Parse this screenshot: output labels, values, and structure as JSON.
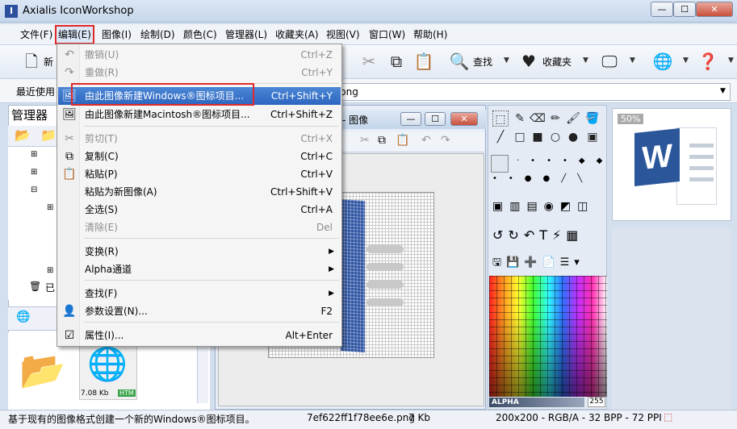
{
  "window": {
    "title": "Axialis IconWorkshop",
    "app_icon": "I",
    "min_label": "—",
    "max_label": "☐",
    "close_label": "✕"
  },
  "menubar": {
    "items": [
      "文件(F)",
      "编辑(E)",
      "图像(I)",
      "绘制(D)",
      "颜色(C)",
      "管理器(L)",
      "收藏夹(A)",
      "视图(V)",
      "窗口(W)",
      "帮助(H)"
    ]
  },
  "toolbar": {
    "new_label": "新",
    "find_label": "查找",
    "favorites_label": "收藏夹"
  },
  "recent": {
    "label": "最近使用",
    "value": "png"
  },
  "left_panel": {
    "title": "管理器",
    "tree_fragment": "已",
    "thumb_size": "7.08 Kb",
    "thumb_badge": "HTM"
  },
  "doc": {
    "title": "- 图像"
  },
  "preview": {
    "zoom": "50%",
    "word_letter": "W"
  },
  "palette": {
    "alpha_label": "ALPHA",
    "alpha_value": "255"
  },
  "status": {
    "message": "基于现有的图像格式创建一个新的Windows®图标项目。",
    "filename": "7ef622ff1f78ee6e.png",
    "filesize": "7 Kb",
    "image_info": "200x200 - RGB/A - 32 BPP - 72 PPI"
  },
  "edit_menu": {
    "undo": {
      "label": "撤销(U)",
      "shortcut": "Ctrl+Z"
    },
    "redo": {
      "label": "重做(R)",
      "shortcut": "Ctrl+Y"
    },
    "new_windows": {
      "label": "由此图像新建Windows®图标项目...",
      "shortcut": "Ctrl+Shift+Y"
    },
    "new_macintosh": {
      "label": "由此图像新建Macintosh®图标项目...",
      "shortcut": "Ctrl+Shift+Z"
    },
    "cut": {
      "label": "剪切(T)",
      "shortcut": "Ctrl+X"
    },
    "copy": {
      "label": "复制(C)",
      "shortcut": "Ctrl+C"
    },
    "paste": {
      "label": "粘贴(P)",
      "shortcut": "Ctrl+V"
    },
    "paste_new": {
      "label": "粘贴为新图像(A)",
      "shortcut": "Ctrl+Shift+V"
    },
    "select_all": {
      "label": "全选(S)",
      "shortcut": "Ctrl+A"
    },
    "clear": {
      "label": "清除(E)",
      "shortcut": "Del"
    },
    "transform": {
      "label": "变换(R)"
    },
    "alpha": {
      "label": "Alpha通道"
    },
    "find": {
      "label": "查找(F)"
    },
    "preferences": {
      "label": "参数设置(N)...",
      "shortcut": "F2"
    },
    "properties": {
      "label": "属性(I)...",
      "shortcut": "Alt+Enter"
    }
  },
  "colors": {
    "highlight": "#2c66c0",
    "annotation_red": "#e0282a",
    "word_blue": "#2b579a"
  }
}
